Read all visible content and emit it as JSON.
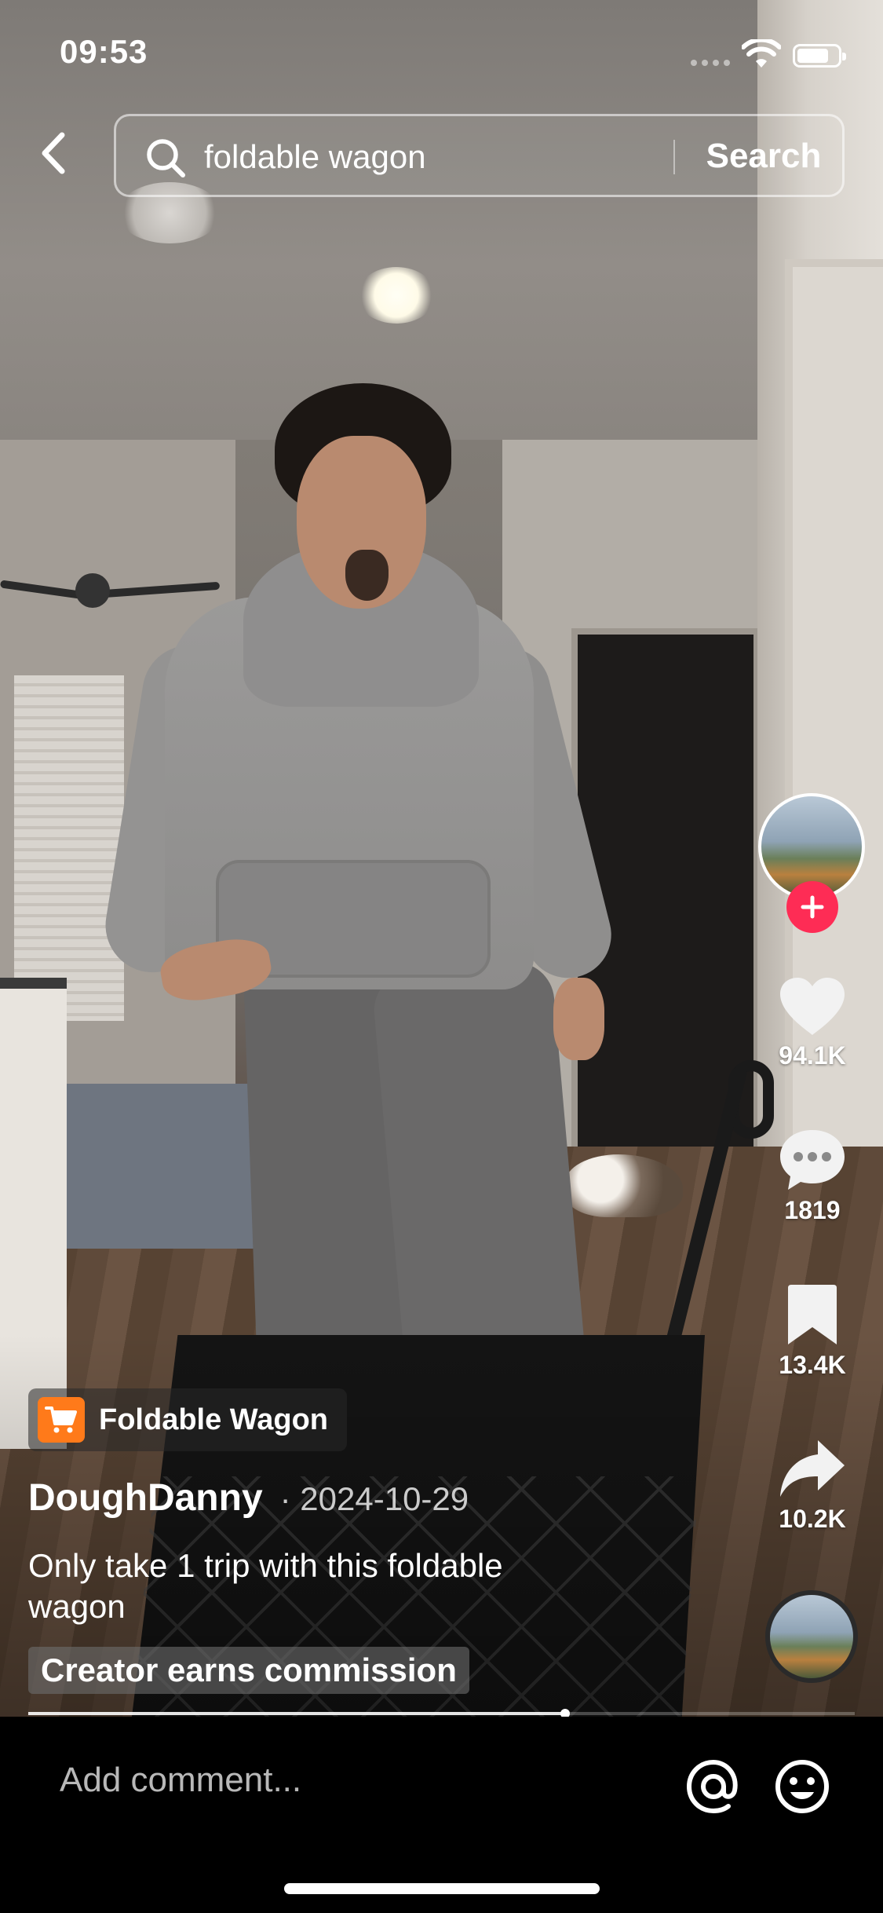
{
  "status_bar": {
    "time": "09:53"
  },
  "search": {
    "query": "foldable wagon",
    "button_label": "Search"
  },
  "actions": {
    "likes": "94.1K",
    "comments": "1819",
    "saves": "13.4K",
    "shares": "10.2K"
  },
  "product": {
    "name": "Foldable Wagon"
  },
  "post": {
    "username": "DoughDanny",
    "date": "· 2024-10-29",
    "caption": "Only take 1 trip with this foldable wagon",
    "commission_label": "Creator earns commission"
  },
  "playback": {
    "progress_fraction": 0.65
  },
  "comment_bar": {
    "placeholder": "Add comment..."
  },
  "colors": {
    "follow_badge": "#fe2c55",
    "cart_badge": "#ff7a1a"
  },
  "icons": {
    "back": "chevron-left-icon",
    "search": "search-icon",
    "like": "heart-icon",
    "comment": "speech-bubble-icon",
    "save": "bookmark-icon",
    "share": "share-arrow-icon",
    "mention": "at-sign-icon",
    "emoji": "smiley-icon",
    "product": "shopping-cart-icon"
  }
}
